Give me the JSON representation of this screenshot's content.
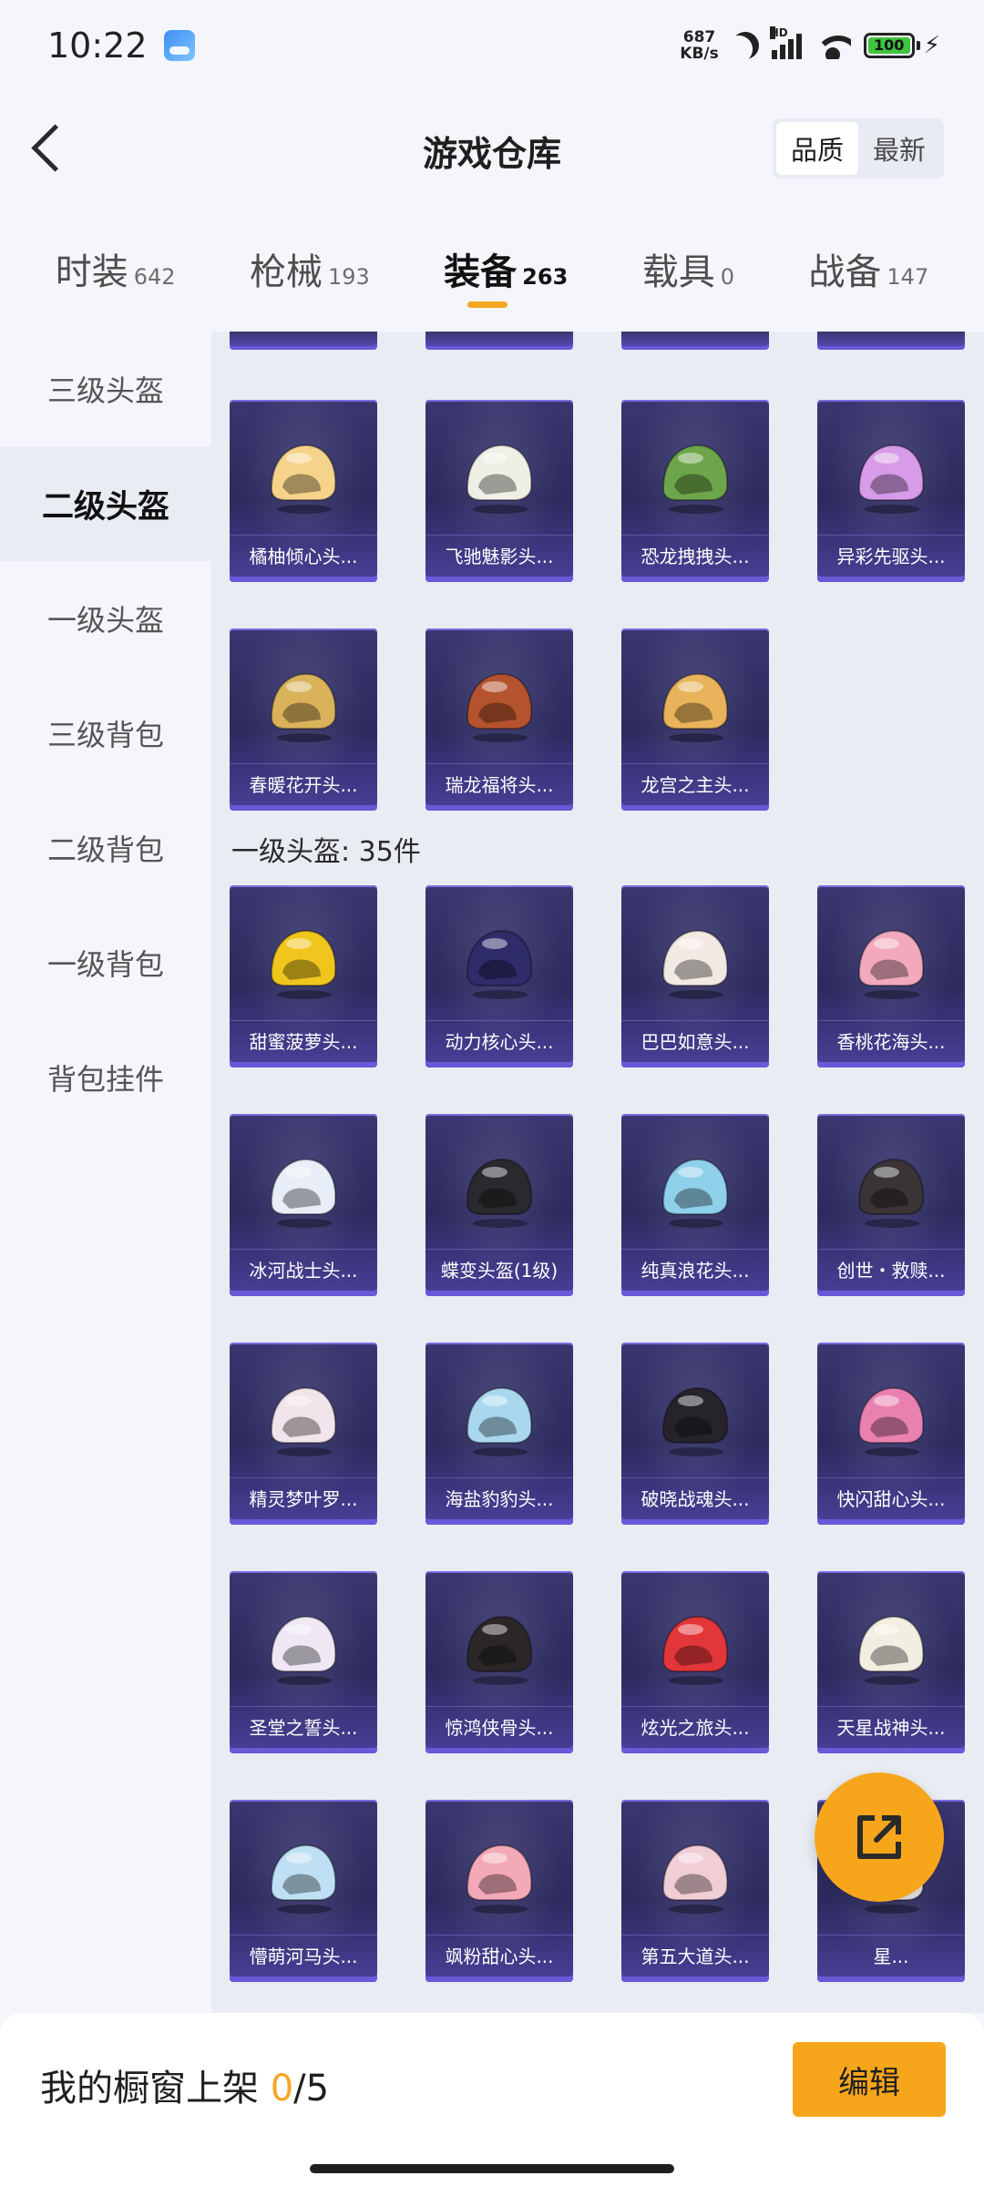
{
  "status_bar": {
    "time": "10:22",
    "net_speed_value": "687",
    "net_speed_unit": "KB/s",
    "signal_label": "HD",
    "battery": "100"
  },
  "header": {
    "title": "游戏仓库",
    "sort_options": [
      "品质",
      "最新"
    ],
    "active_sort": "品质"
  },
  "tabs": [
    {
      "label": "时装",
      "count": "642"
    },
    {
      "label": "枪械",
      "count": "193"
    },
    {
      "label": "装备",
      "count": "263",
      "active": true
    },
    {
      "label": "载具",
      "count": "0"
    },
    {
      "label": "战备",
      "count": "147"
    }
  ],
  "sidebar": {
    "items": [
      "三级头盔",
      "二级头盔",
      "一级头盔",
      "三级背包",
      "二级背包",
      "一级背包",
      "背包挂件"
    ],
    "active": "二级头盔"
  },
  "content": {
    "level2_items": [
      {
        "name": "橘柚倾心头...",
        "icon": "orange-helmet-icon",
        "color": "#f6d38a"
      },
      {
        "name": "飞驰魅影头...",
        "icon": "winged-helmet-icon",
        "color": "#f0efe6"
      },
      {
        "name": "恐龙拽拽头...",
        "icon": "frog-helmet-icon",
        "color": "#6da64a"
      },
      {
        "name": "异彩先驱头...",
        "icon": "chameleon-helmet-icon",
        "color": "#d79be8"
      },
      {
        "name": "春暖花开头...",
        "icon": "flower-helmet-icon",
        "color": "#d9b25a"
      },
      {
        "name": "瑞龙福将头...",
        "icon": "dragon-helmet-icon",
        "color": "#b5532f"
      },
      {
        "name": "龙宫之主头...",
        "icon": "dragon-palace-helmet-icon",
        "color": "#e8b35a"
      }
    ],
    "level1_section_title": "一级头盔: 35件",
    "level1_items": [
      {
        "name": "甜蜜菠萝头...",
        "icon": "pineapple-helmet-icon",
        "color": "#f0c61e"
      },
      {
        "name": "动力核心头...",
        "icon": "power-core-helmet-icon",
        "color": "#2f2c6a"
      },
      {
        "name": "巴巴如意头...",
        "icon": "white-helmet-icon",
        "color": "#f2e9e3"
      },
      {
        "name": "香桃花海头...",
        "icon": "peach-helmet-icon",
        "color": "#f2a9be"
      },
      {
        "name": "冰河战士头...",
        "icon": "ice-helmet-icon",
        "color": "#e8eef8"
      },
      {
        "name": "蝶变头盔(1级)",
        "icon": "black-helmet-icon",
        "color": "#2a2a2e"
      },
      {
        "name": "纯真浪花头...",
        "icon": "wave-helmet-icon",
        "color": "#8fd0ea"
      },
      {
        "name": "创世・救赎...",
        "icon": "genesis-helmet-icon",
        "color": "#3a3436"
      },
      {
        "name": "精灵梦叶罗...",
        "icon": "elf-helmet-icon",
        "color": "#f1e4ea"
      },
      {
        "name": "海盐豹豹头...",
        "icon": "seal-helmet-icon",
        "color": "#a9d8ee"
      },
      {
        "name": "破晓战魂头...",
        "icon": "spiked-helmet-icon",
        "color": "#26242a"
      },
      {
        "name": "快闪甜心头...",
        "icon": "sweetheart-helmet-icon",
        "color": "#e981b0"
      },
      {
        "name": "圣堂之誓头...",
        "icon": "temple-helmet-icon",
        "color": "#efe8f4"
      },
      {
        "name": "惊鸿侠骨头...",
        "icon": "knight-helmet-icon",
        "color": "#2b2728"
      },
      {
        "name": "炫光之旅头...",
        "icon": "red-helmet-icon",
        "color": "#e2363a"
      },
      {
        "name": "天星战神头...",
        "icon": "star-helmet-icon",
        "color": "#f2efe2"
      },
      {
        "name": "懵萌河马头...",
        "icon": "hippo-helmet-icon",
        "color": "#bfe0f4"
      },
      {
        "name": "飒粉甜心头...",
        "icon": "pink-helmet-icon",
        "color": "#f3a9b8"
      },
      {
        "name": "第五大道头...",
        "icon": "plaid-helmet-icon",
        "color": "#f1cdd6"
      },
      {
        "name": "星...",
        "icon": "helmet-icon",
        "color": "#f0eef2"
      }
    ]
  },
  "fab_icon": "share-external-icon",
  "bottom_bar": {
    "label": "我的橱窗上架",
    "current": "0",
    "total": "/5",
    "edit_label": "编辑"
  }
}
